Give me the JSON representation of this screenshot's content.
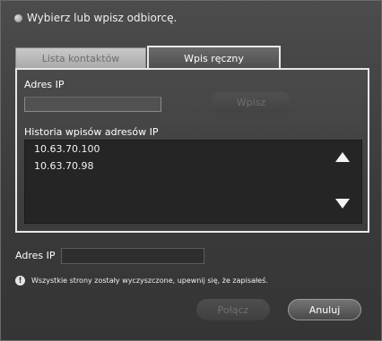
{
  "prompt": "Wybierz lub wpisz odbiorcę.",
  "tabs": {
    "contacts": "Lista kontaktów",
    "manual": "Wpis ręczny"
  },
  "panel": {
    "ip_label": "Adres IP",
    "ip_value": "",
    "enter_button": "Wpisz",
    "history_label": "Historia wpisów adresów IP",
    "history": [
      "10.63.70.100",
      "10.63.70.98"
    ]
  },
  "footer": {
    "ip_label": "Adres IP",
    "ip_value": "",
    "warning": "Wszystkie strony zostały wyczyszczone, upewnij się, że zapisałeś.",
    "warning_icon_glyph": "!",
    "connect_button": "Połącz",
    "cancel_button": "Anuluj"
  },
  "icons": {
    "scroll_up": "triangle-up-icon",
    "scroll_down": "triangle-down-icon",
    "warning": "exclamation-circle-icon"
  }
}
